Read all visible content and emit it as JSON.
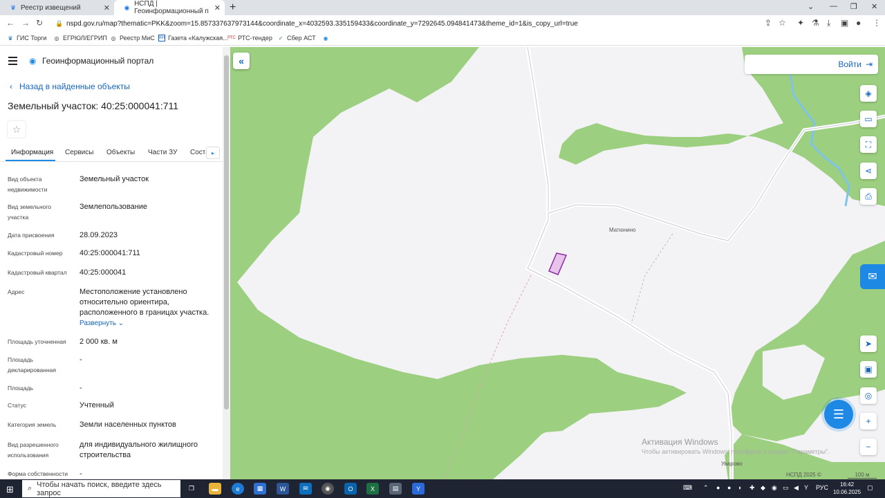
{
  "browser": {
    "tabs": [
      {
        "title": "Реестр извещений",
        "active": false
      },
      {
        "title": "НСПД | Геоинформационный п",
        "active": true
      }
    ],
    "url": "nspd.gov.ru/map?thematic=PKK&zoom=15.857337637973144&coordinate_x=4032593.335159433&coordinate_y=7292645.094841473&theme_id=1&is_copy_url=true",
    "bookmarks": [
      "ГИС Торги",
      "ЕГРЮЛ/ЕГРИП",
      "Реестр МиС",
      "Газета «Калужская...",
      "РТС-тендер",
      "Сбер АСТ"
    ],
    "bookmark_badges": [
      "КН",
      "РТС"
    ]
  },
  "portal": {
    "title": "Геоинформационный портал",
    "back_label": "Назад в найденные объекты",
    "object_title": "Земельный участок: 40:25:000041:711",
    "tabs": [
      "Информация",
      "Сервисы",
      "Объекты",
      "Части ЗУ",
      "Соста"
    ]
  },
  "properties": [
    {
      "label": "Вид объекта недвижимости",
      "value": "Земельный участок"
    },
    {
      "label": "Вид земельного участка",
      "value": "Землепользование"
    },
    {
      "label": "Дата присвоения",
      "value": "28.09.2023"
    },
    {
      "label": "Кадастровый номер",
      "value": "40:25:000041:711"
    },
    {
      "label": "Кадастровый квартал",
      "value": "40:25:000041"
    },
    {
      "label": "Адрес",
      "value": "Местоположение установлено относительно ориентира, расположенного в границах участка.",
      "expand": "Развернуть"
    },
    {
      "label": "Площадь уточненная",
      "value": "2 000 кв. м"
    },
    {
      "label": "Площадь декларированная",
      "value": "-"
    },
    {
      "label": "Площадь",
      "value": "-"
    },
    {
      "label": "Статус",
      "value": "Учтенный"
    },
    {
      "label": "Категория земель",
      "value": "Земли населенных пунктов"
    },
    {
      "label": "Вид разрешенного использования",
      "value": "для индивидуального жилищного строительства"
    },
    {
      "label": "Форма собственности",
      "value": "-"
    }
  ],
  "map": {
    "login_label": "Войти",
    "labels": {
      "village": "Матюнино",
      "village2": "Уварово"
    },
    "watermark_title": "Активация Windows",
    "watermark_sub": "Чтобы активировать Windows, перейдите в раздел \"Параметры\".",
    "copyright": "НСПД 2025 ©",
    "scale": "100 м",
    "colors": {
      "forest": "#9ccf7f",
      "parcel": "#e8c4ec",
      "parcel_border": "#8a2ba5",
      "accent": "#1e88e5"
    }
  },
  "taskbar": {
    "search_placeholder": "Чтобы начать поиск, введите здесь запрос",
    "lang": "РУС",
    "time": "16:42",
    "date": "10.06.2025"
  }
}
